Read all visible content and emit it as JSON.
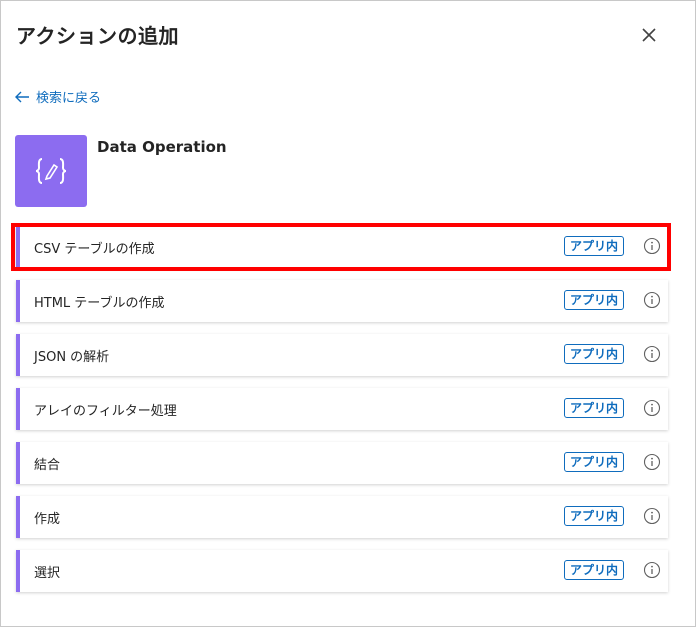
{
  "panel": {
    "title": "アクションの追加",
    "close_icon": "close-icon",
    "back_label": "検索に戻る"
  },
  "connector": {
    "name": "Data Operation",
    "icon": "data-operation-icon",
    "color": "#8c6cf0"
  },
  "actions": [
    {
      "label": "CSV テーブルの作成",
      "badge": "アプリ内",
      "highlighted": true
    },
    {
      "label": "HTML テーブルの作成",
      "badge": "アプリ内"
    },
    {
      "label": "JSON の解析",
      "badge": "アプリ内"
    },
    {
      "label": "アレイのフィルター処理",
      "badge": "アプリ内"
    },
    {
      "label": "結合",
      "badge": "アプリ内"
    },
    {
      "label": "作成",
      "badge": "アプリ内"
    },
    {
      "label": "選択",
      "badge": "アプリ内"
    }
  ],
  "colors": {
    "accent": "#0f6cbd",
    "highlight": "#ff0000"
  }
}
